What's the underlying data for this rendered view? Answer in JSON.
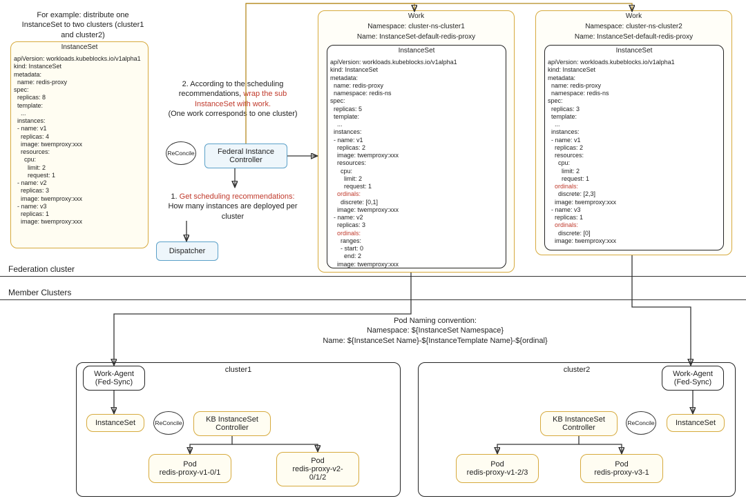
{
  "example_note": "For example: distribute one\nInstanceSet to two clusters\n(cluster1 and cluster2)",
  "sourceIS": {
    "title": "InstanceSet",
    "yaml": "apiVersion: workloads.kubeblocks.io/v1alpha1\nkind: InstanceSet\nmetadata:\n  name: redis-proxy\nspec:\n  replicas: 8\n  template:\n    ...\n  instances:\n  - name: v1\n    replicas: 4\n    image: twemproxy:xxx\n    resources:\n      cpu:\n        limit: 2\n        request: 1\n  - name: v2\n    replicas: 3\n    image: twemproxy:xxx\n  - name: v3\n    replicas: 1\n    image: twemproxy:xxx"
  },
  "step2": {
    "prefix": "2. According to the scheduling\nrecommendations, ",
    "highlight": "wrap the sub\nInstanceSet with work.",
    "suffix": "(One work corresponds\nto one cluster)"
  },
  "step1": {
    "prefix": "1. ",
    "highlight": "Get scheduling recommendations:",
    "suffix": "How many instances are deployed\nper cluster"
  },
  "fedController": "Federal Instance\nController",
  "dispatcher": "Dispatcher",
  "reconcile": "ReConcile",
  "work1": {
    "title": "Work",
    "ns": "Namespace: cluster-ns-cluster1",
    "name": "Name: InstanceSet-default-redis-proxy",
    "isTitle": "InstanceSet",
    "yaml": "apiVersion: workloads.kubeblocks.io/v1alpha1\nkind: InstanceSet\nmetadata:\n  name: redis-proxy\n  namespace: redis-ns\nspec:\n  replicas: 5\n  template:\n    ...\n  instances:\n  - name: v1\n    replicas: 2\n    image: twemproxy:xxx\n    resources:\n      cpu:\n        limit: 2\n        request: 1\n    ordinals:\n      discrete: [0,1]\n    image: twemproxy:xxx\n  - name: v2\n    replicas: 3\n    ordinals:\n      ranges:\n      - start: 0\n        end: 2\n    image: twemproxy:xxx"
  },
  "work2": {
    "title": "Work",
    "ns": "Namespace: cluster-ns-cluster2",
    "name": "Name: InstanceSet-default-redis-proxy",
    "isTitle": "InstanceSet",
    "yaml": "apiVersion: workloads.kubeblocks.io/v1alpha1\nkind: InstanceSet\nmetadata:\n  name: redis-proxy\n  namespace: redis-ns\nspec:\n  replicas: 3\n  template:\n    ...\n  instances:\n  - name: v1\n    replicas: 2\n    resources:\n      cpu:\n        limit: 2\n        request: 1\n    ordinals:\n      discrete: [2,3]\n    image: twemproxy:xxx\n  - name: v3\n    replicas: 1\n    ordinals:\n      discrete: [0]\n    image: twemproxy:xxx"
  },
  "fedClusterLabel": "Federation cluster",
  "memberClustersLabel": "Member Clusters",
  "podNaming": {
    "line1": "Pod Naming convention:",
    "line2": "Namespace: ${InstanceSet Namespace}",
    "line3": "Name: ${InstanceSet Name}-${InstanceTemplate Name}-${ordinal}"
  },
  "cluster1": {
    "label": "cluster1",
    "workAgent": "Work-Agent\n(Fed-Sync)",
    "instanceSet": "InstanceSet",
    "controller": "KB InstanceSet\nController",
    "pod1": "Pod\nredis-proxy-v1-0/1",
    "pod2": "Pod\nredis-proxy-v2-\n0/1/2"
  },
  "cluster2": {
    "label": "cluster2",
    "workAgent": "Work-Agent\n(Fed-Sync)",
    "instanceSet": "InstanceSet",
    "controller": "KB InstanceSet\nController",
    "pod1": "Pod\nredis-proxy-v1-2/3",
    "pod2": "Pod\nredis-proxy-v3-1"
  }
}
